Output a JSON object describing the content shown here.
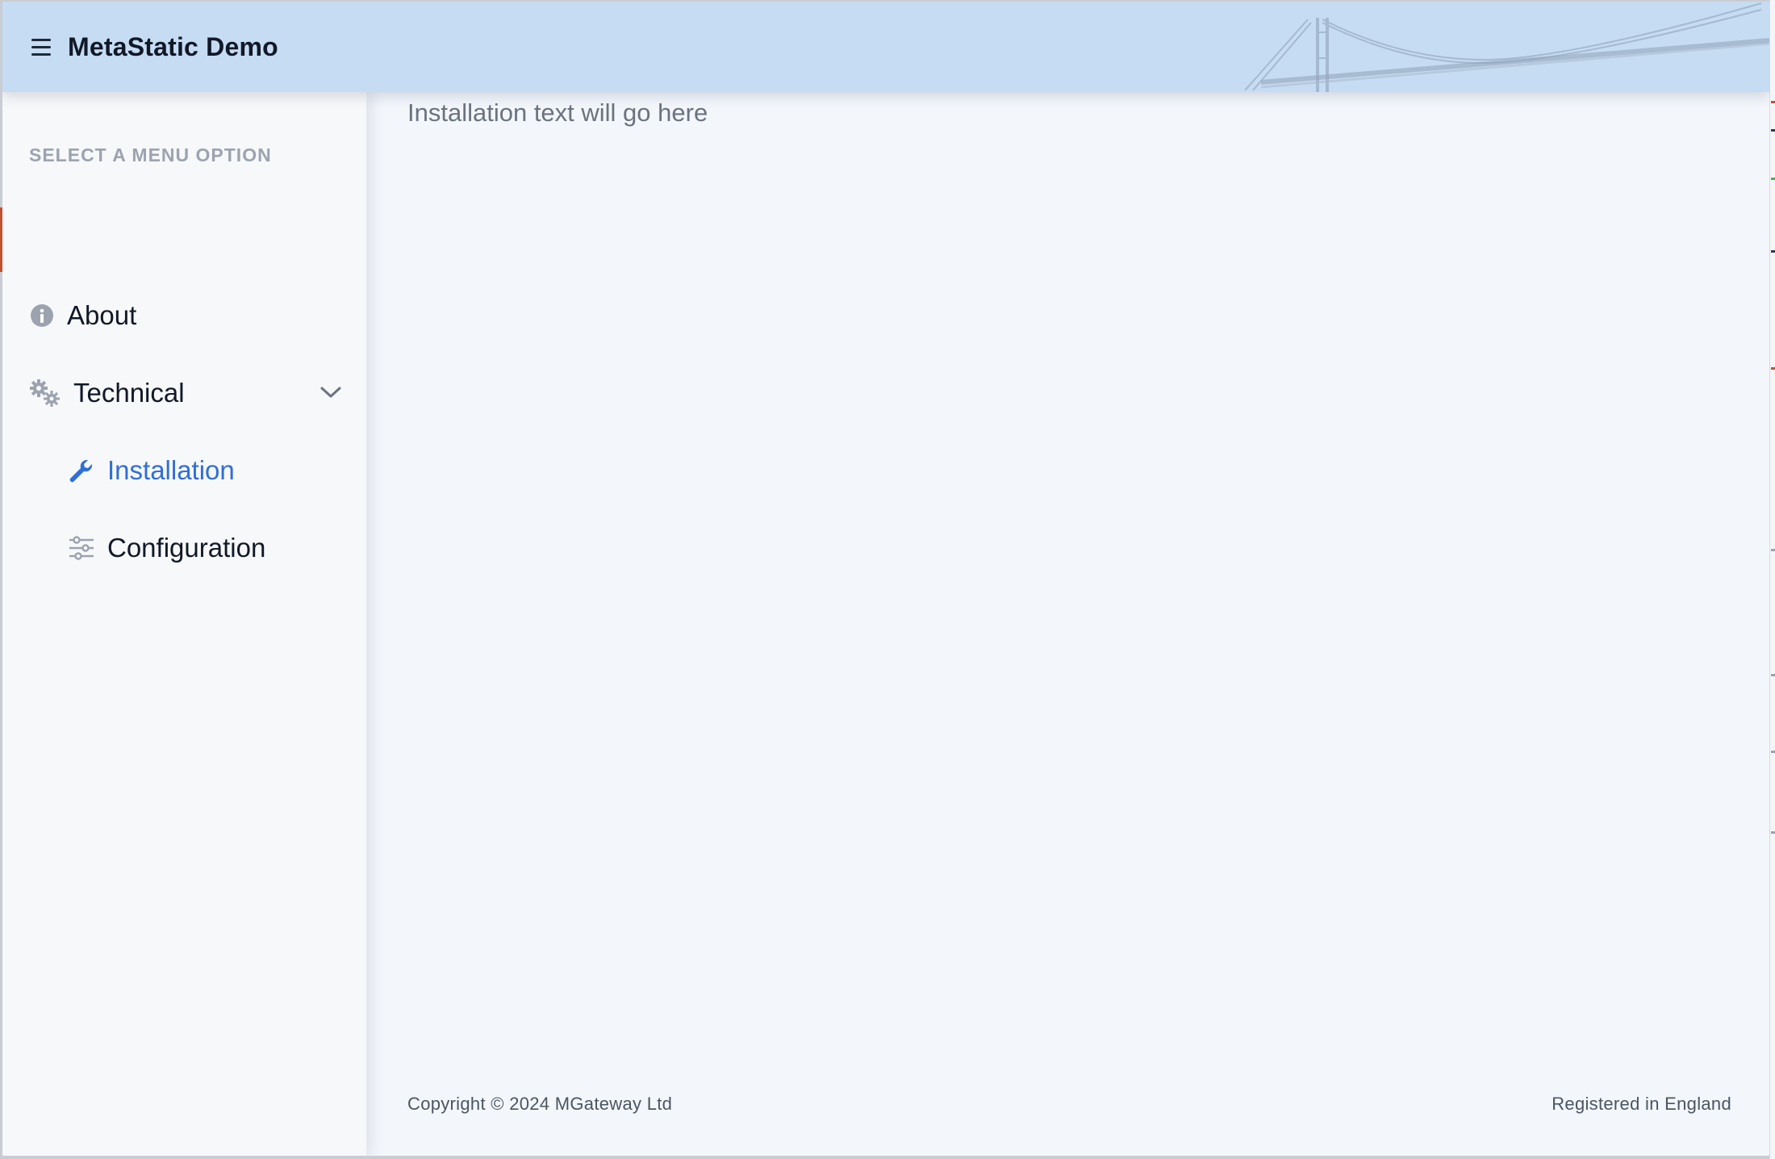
{
  "header": {
    "title": "MetaStatic Demo",
    "menu_icon": "hamburger-menu-icon",
    "background_color": "#c6dcf3"
  },
  "sidebar": {
    "heading": "SELECT A MENU OPTION",
    "items": [
      {
        "label": "About",
        "icon": "info-circle-icon",
        "active": false
      },
      {
        "label": "Technical",
        "icon": "gears-icon",
        "expanded": true,
        "toggle_icon": "chevron-down-icon"
      },
      {
        "label": "Installation",
        "icon": "wrench-icon",
        "active": true,
        "indent": 1
      },
      {
        "label": "Configuration",
        "icon": "sliders-icon",
        "active": false,
        "indent": 1
      }
    ],
    "active_color": "#2f6fd8"
  },
  "main": {
    "content_text": "Installation text will go here"
  },
  "footer": {
    "copyright": "Copyright © 2024 MGateway Ltd",
    "registered": "Registered in England"
  }
}
